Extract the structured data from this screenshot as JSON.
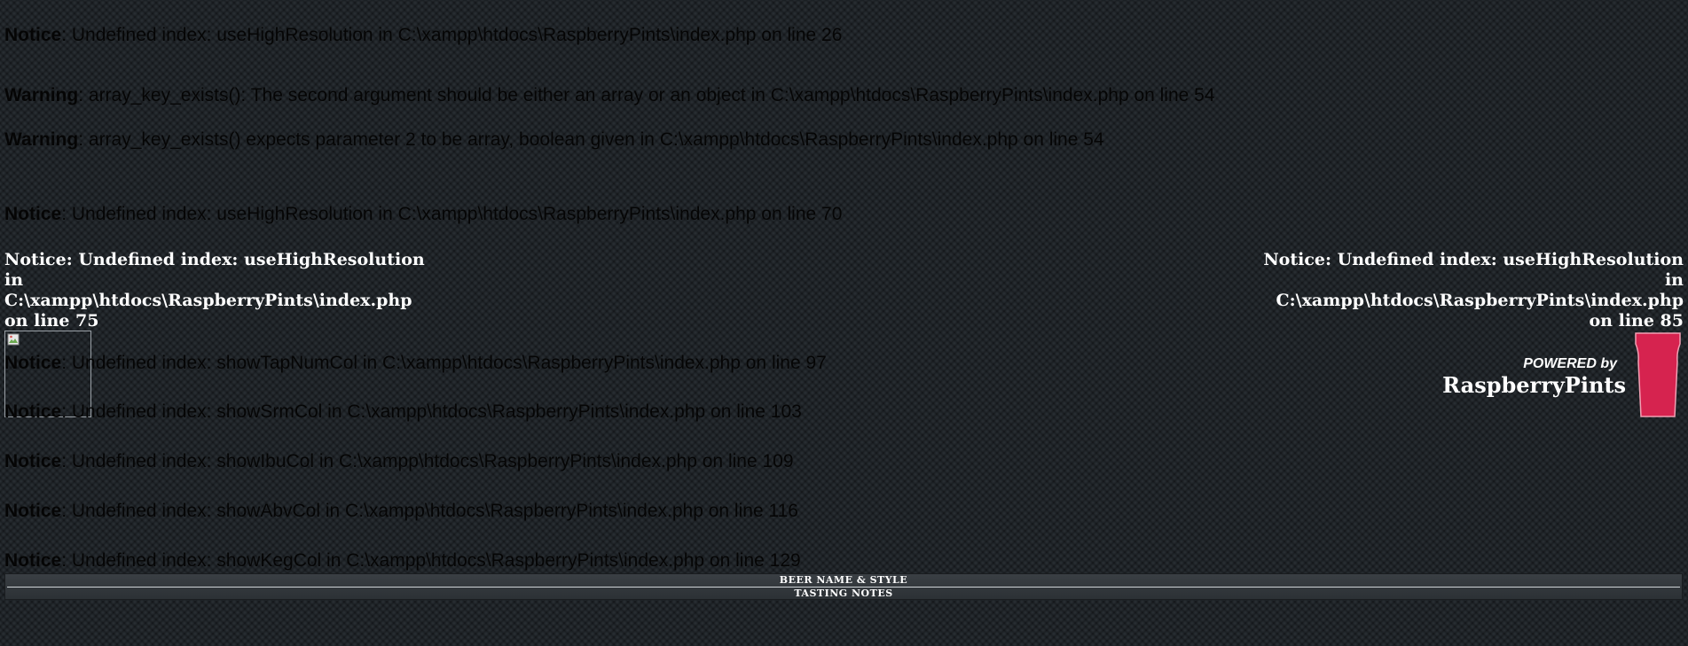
{
  "notices": [
    {
      "label": "Notice",
      "text": ": Undefined index: useHighResolution in C:\\xampp\\htdocs\\RaspberryPints\\index.php on line 26"
    },
    {
      "label": "Warning",
      "text": ": array_key_exists(): The second argument should be either an array or an object in C:\\xampp\\htdocs\\RaspberryPints\\index.php on line 54"
    },
    {
      "label": "Warning",
      "text": ": array_key_exists() expects parameter 2 to be array, boolean given in C:\\xampp\\htdocs\\RaspberryPints\\index.php on line 54"
    },
    {
      "label": "Notice",
      "text": ": Undefined index: useHighResolution in C:\\xampp\\htdocs\\RaspberryPints\\index.php on line 70"
    }
  ],
  "side_notices": {
    "left": {
      "line1": "Notice: Undefined index: useHighResolution",
      "line2": "in",
      "line3": "C:\\xampp\\htdocs\\RaspberryPints\\index.php",
      "line4": "on line 75"
    },
    "right": {
      "line1": "Notice: Undefined index: useHighResolution",
      "line2": "in",
      "line3": "C:\\xampp\\htdocs\\RaspberryPints\\index.php",
      "line4": "on line 85"
    }
  },
  "column_notices": [
    {
      "label": "Notice",
      "text": ": Undefined index: showTapNumCol in C:\\xampp\\htdocs\\RaspberryPints\\index.php on line 97"
    },
    {
      "label": "Notice",
      "text": ": Undefined index: showSrmCol in C:\\xampp\\htdocs\\RaspberryPints\\index.php on line 103"
    },
    {
      "label": "Notice",
      "text": ": Undefined index: showIbuCol in C:\\xampp\\htdocs\\RaspberryPints\\index.php on line 109"
    },
    {
      "label": "Notice",
      "text": ": Undefined index: showAbvCol in C:\\xampp\\htdocs\\RaspberryPints\\index.php on line 116"
    },
    {
      "label": "Notice",
      "text": ": Undefined index: showKegCol in C:\\xampp\\htdocs\\RaspberryPints\\index.php on line 129"
    }
  ],
  "powered": {
    "by": "POWERED by",
    "name": "RaspberryPints"
  },
  "table": {
    "col1": "BEER NAME  &  STYLE",
    "col2": "TASTING NOTES"
  },
  "icons": {
    "logo": "broken-image-icon",
    "pint": "pint-glass-icon"
  },
  "colors": {
    "pint": "#d6234f",
    "background": "#15181b",
    "error_text": "#050505"
  }
}
